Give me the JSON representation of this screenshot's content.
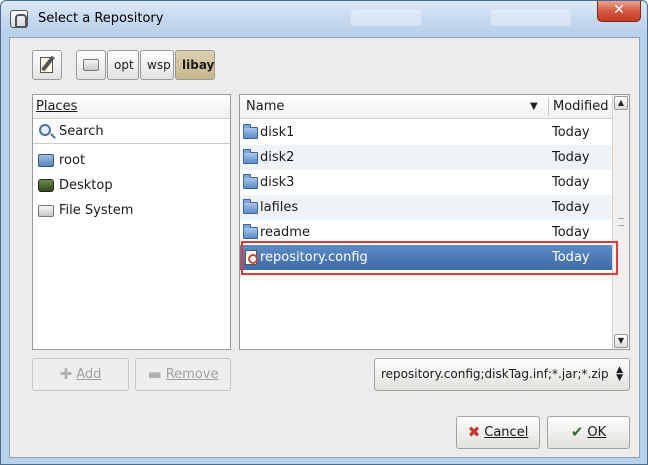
{
  "window": {
    "title": "Select a Repository",
    "close_glyph": "✕"
  },
  "toolbar": {
    "crumbs": [
      "opt",
      "wsp",
      "libay"
    ],
    "active_crumb": "libay"
  },
  "places": {
    "header": "Places",
    "items": [
      {
        "label": "Search",
        "icon": "search-icon"
      },
      {
        "label": "root",
        "icon": "home-folder-icon"
      },
      {
        "label": "Desktop",
        "icon": "desktop-icon"
      },
      {
        "label": "File System",
        "icon": "drive-icon"
      }
    ]
  },
  "files": {
    "columns": {
      "name": "Name",
      "modified": "Modified"
    },
    "sort_glyph": "▼",
    "rows": [
      {
        "name": "disk1",
        "modified": "Today",
        "type": "folder"
      },
      {
        "name": "disk2",
        "modified": "Today",
        "type": "folder"
      },
      {
        "name": "disk3",
        "modified": "Today",
        "type": "folder"
      },
      {
        "name": "lafiles",
        "modified": "Today",
        "type": "folder"
      },
      {
        "name": "readme",
        "modified": "Today",
        "type": "folder"
      },
      {
        "name": "repository.config",
        "modified": "Today",
        "type": "file",
        "selected": true
      }
    ]
  },
  "buttons": {
    "add": "Add",
    "remove": "Remove",
    "cancel": "Cancel",
    "ok": "OK"
  },
  "filter": {
    "value": "repository.config;diskTag.inf;*.jar;*.zip"
  },
  "colors": {
    "selection": "#3e6aa6",
    "highlight": "#e53935",
    "titlebar": "#c4d8ee"
  }
}
